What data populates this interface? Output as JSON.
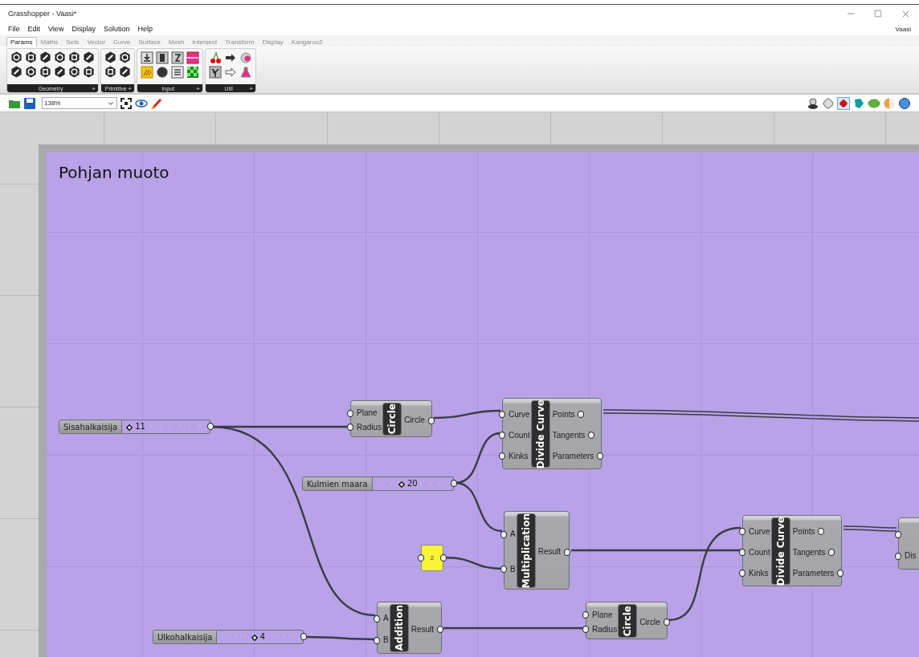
{
  "window": {
    "title": "Grasshopper - Vaasi*",
    "document": "Vaasi"
  },
  "menu": [
    "File",
    "Edit",
    "View",
    "Display",
    "Solution",
    "Help"
  ],
  "tabs": [
    {
      "label": "Params",
      "selected": true
    },
    {
      "label": "Maths",
      "selected": false
    },
    {
      "label": "Sets",
      "selected": false
    },
    {
      "label": "Vector",
      "selected": false
    },
    {
      "label": "Curve",
      "selected": false
    },
    {
      "label": "Surface",
      "selected": false
    },
    {
      "label": "Mesh",
      "selected": false
    },
    {
      "label": "Intersect",
      "selected": false
    },
    {
      "label": "Transform",
      "selected": false
    },
    {
      "label": "Display",
      "selected": false
    },
    {
      "label": "Kangaroo2",
      "selected": false
    }
  ],
  "ribbon_groups": [
    {
      "name": "Geometry",
      "expand": "+"
    },
    {
      "name": "Primitive",
      "expand": "+"
    },
    {
      "name": "Input",
      "expand": "+"
    },
    {
      "name": "Util",
      "expand": "+"
    }
  ],
  "toolbar": {
    "zoom": "138%"
  },
  "canvas": {
    "group_title": "Pohjan muoto",
    "nodes": [
      {
        "kind": "slider",
        "name": "Sisahalkaisija",
        "value": "11",
        "level": 0.05
      },
      {
        "kind": "component",
        "title": "Circle",
        "inputs": [
          "Plane",
          "Radius"
        ],
        "outputs": [
          "Circle"
        ]
      },
      {
        "kind": "component",
        "title": "Divide Curve",
        "inputs": [
          "Curve",
          "Count",
          "Kinks"
        ],
        "outputs": [
          "Points",
          "Tangents",
          "Parameters"
        ]
      },
      {
        "kind": "slider",
        "name": "Kulmien maara",
        "value": "20",
        "level": 0.35
      },
      {
        "kind": "component",
        "title": "Multiplication",
        "inputs": [
          "A",
          "B"
        ],
        "outputs": [
          "Result"
        ]
      },
      {
        "kind": "panel",
        "value": "2"
      },
      {
        "kind": "component",
        "title": "Divide Curve",
        "inputs": [
          "Curve",
          "Count",
          "Kinks"
        ],
        "outputs": [
          "Points",
          "Tangents",
          "Parameters"
        ]
      },
      {
        "kind": "partial",
        "inputs": [
          "Dis"
        ]
      },
      {
        "kind": "component",
        "title": "Circle",
        "inputs": [
          "Plane",
          "Radius"
        ],
        "outputs": [
          "Circle"
        ]
      },
      {
        "kind": "component",
        "title": "Addition",
        "inputs": [
          "A",
          "B"
        ],
        "outputs": [
          "Result"
        ]
      },
      {
        "kind": "slider",
        "name": "Ulkohalkaisija",
        "value": "4",
        "level": 0.43
      }
    ]
  }
}
